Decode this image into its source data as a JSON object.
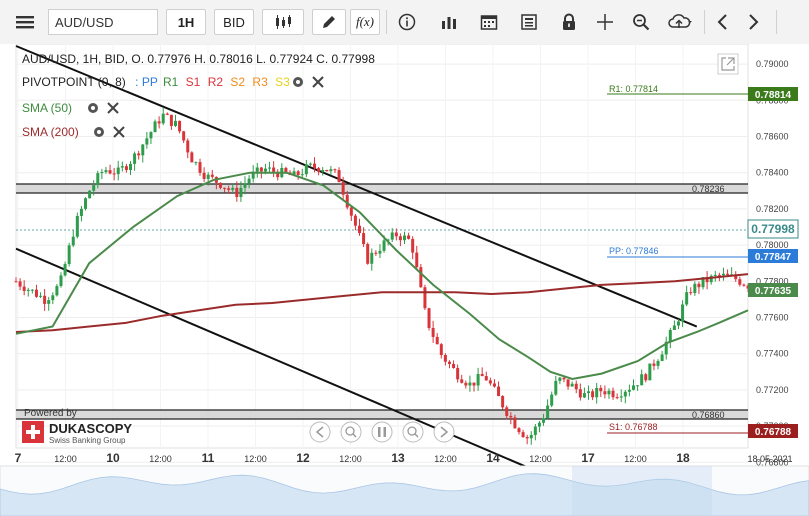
{
  "toolbar": {
    "symbol": "AUD/USD",
    "timeframe": "1H",
    "price_side": "BID",
    "fx_label": "f(x)"
  },
  "header": {
    "ohlc_line": "AUD/USD, 1H, BID,   O. 0.77976 H. 0.78016 L. 0.77924 C. 0.77998",
    "pivot_label": "PIVOTPOINT (0, 8)",
    "pivot_items": [
      {
        "text": ": PP",
        "color": "#2b7bd8"
      },
      {
        "text": "R1",
        "color": "#3d8b3d"
      },
      {
        "text": "S1",
        "color": "#d8343a"
      },
      {
        "text": "R2",
        "color": "#d8343a"
      },
      {
        "text": "S2",
        "color": "#f08a1c"
      },
      {
        "text": "R3",
        "color": "#f08a1c"
      },
      {
        "text": "S3",
        "color": "#e8d21c"
      }
    ],
    "sma50_label": "SMA (50)",
    "sma200_label": "SMA (200)"
  },
  "branding": {
    "powered_by": "Powered by",
    "name": "DUKASCOPY",
    "subtitle": "Swiss Banking Group"
  },
  "colors": {
    "up": "#2e9d4b",
    "down": "#d8343a",
    "sma50": "#4a8a4a",
    "sma200": "#9b2b2b",
    "pp": "#2b7bd8",
    "r1": "#3a7a1a",
    "s1": "#9b1f1f"
  },
  "chart_data": {
    "type": "candlestick",
    "symbol": "AUD/USD",
    "timeframe": "1H",
    "ylim": [
      0.7689,
      0.791
    ],
    "y_ticks": [
      "0.79000",
      "0.78800",
      "0.78600",
      "0.78400",
      "0.78200",
      "0.78000",
      "0.77800",
      "0.77600",
      "0.77400",
      "0.77200",
      "0.77000",
      "0.76800"
    ],
    "x_labels": [
      "7",
      "12:00",
      "10",
      "12:00",
      "11",
      "12:00",
      "12",
      "12:00",
      "13",
      "12:00",
      "14",
      "12:00",
      "17",
      "12:00",
      "18",
      "18.05.2021"
    ],
    "levels": [
      {
        "name": "R1",
        "label": "R1: 0.77814",
        "value": 0.77814,
        "tag": "0.78814",
        "color": "#3a7a1a"
      },
      {
        "name": "resistance",
        "label": "0.78236",
        "value": 0.78236
      },
      {
        "name": "PP",
        "label": "PP: 0.77846",
        "value": 0.77846,
        "tag": "0.77847",
        "color": "#2b7bd8"
      },
      {
        "name": "support",
        "label": "0.76860",
        "value": 0.7686
      },
      {
        "name": "S1",
        "label": "S1: 0.76788",
        "value": 0.76788,
        "tag": "0.76788",
        "color": "#9b1f1f"
      }
    ],
    "price_tags": [
      {
        "value": 0.77998,
        "text": "0.77998",
        "style": "current"
      },
      {
        "value": 0.77635,
        "text": "0.77635",
        "style": "sma50"
      }
    ],
    "trendlines": [
      {
        "from": [
          0.0,
          0.791
        ],
        "to": [
          0.93,
          0.7755
        ]
      },
      {
        "from": [
          0.0,
          0.7798
        ],
        "to": [
          0.7,
          0.7677
        ]
      }
    ],
    "sma50": [
      [
        0.0,
        0.7751
      ],
      [
        0.05,
        0.7755
      ],
      [
        0.1,
        0.779
      ],
      [
        0.16,
        0.781
      ],
      [
        0.22,
        0.7827
      ],
      [
        0.27,
        0.7836
      ],
      [
        0.32,
        0.784
      ],
      [
        0.37,
        0.784
      ],
      [
        0.42,
        0.7833
      ],
      [
        0.47,
        0.7818
      ],
      [
        0.52,
        0.7797
      ],
      [
        0.57,
        0.7778
      ],
      [
        0.62,
        0.7762
      ],
      [
        0.66,
        0.7748
      ],
      [
        0.7,
        0.7738
      ],
      [
        0.73,
        0.773
      ],
      [
        0.76,
        0.7726
      ],
      [
        0.8,
        0.7729
      ],
      [
        0.85,
        0.7736
      ],
      [
        0.89,
        0.7746
      ],
      [
        0.93,
        0.7752
      ],
      [
        0.96,
        0.7757
      ],
      [
        1.0,
        0.7764
      ]
    ],
    "sma200": [
      [
        0.0,
        0.7752
      ],
      [
        0.05,
        0.7753
      ],
      [
        0.1,
        0.7755
      ],
      [
        0.15,
        0.7757
      ],
      [
        0.2,
        0.7761
      ],
      [
        0.25,
        0.7764
      ],
      [
        0.3,
        0.7767
      ],
      [
        0.35,
        0.7768
      ],
      [
        0.4,
        0.777
      ],
      [
        0.45,
        0.7772
      ],
      [
        0.5,
        0.7774
      ],
      [
        0.55,
        0.7774
      ],
      [
        0.6,
        0.7774
      ],
      [
        0.65,
        0.7773
      ],
      [
        0.7,
        0.7774
      ],
      [
        0.75,
        0.7776
      ],
      [
        0.8,
        0.7778
      ],
      [
        0.85,
        0.7779
      ],
      [
        0.9,
        0.778
      ],
      [
        0.95,
        0.7782
      ],
      [
        1.0,
        0.7784
      ]
    ],
    "price_path": [
      [
        0.0,
        0.778
      ],
      [
        0.02,
        0.7775
      ],
      [
        0.04,
        0.777
      ],
      [
        0.06,
        0.7778
      ],
      [
        0.08,
        0.781
      ],
      [
        0.1,
        0.783
      ],
      [
        0.12,
        0.7842
      ],
      [
        0.14,
        0.784
      ],
      [
        0.16,
        0.7848
      ],
      [
        0.18,
        0.786
      ],
      [
        0.2,
        0.7872
      ],
      [
        0.22,
        0.7866
      ],
      [
        0.24,
        0.7848
      ],
      [
        0.26,
        0.7838
      ],
      [
        0.28,
        0.7834
      ],
      [
        0.3,
        0.7828
      ],
      [
        0.32,
        0.7838
      ],
      [
        0.34,
        0.7842
      ],
      [
        0.36,
        0.784
      ],
      [
        0.38,
        0.7838
      ],
      [
        0.4,
        0.7843
      ],
      [
        0.42,
        0.7843
      ],
      [
        0.44,
        0.7838
      ],
      [
        0.46,
        0.7815
      ],
      [
        0.48,
        0.7792
      ],
      [
        0.5,
        0.78
      ],
      [
        0.52,
        0.7806
      ],
      [
        0.54,
        0.7802
      ],
      [
        0.56,
        0.776
      ],
      [
        0.58,
        0.774
      ],
      [
        0.6,
        0.773
      ],
      [
        0.62,
        0.7723
      ],
      [
        0.64,
        0.7728
      ],
      [
        0.66,
        0.7715
      ],
      [
        0.68,
        0.7702
      ],
      [
        0.7,
        0.7693
      ],
      [
        0.72,
        0.7705
      ],
      [
        0.74,
        0.7726
      ],
      [
        0.76,
        0.7722
      ],
      [
        0.78,
        0.7716
      ],
      [
        0.8,
        0.772
      ],
      [
        0.82,
        0.7718
      ],
      [
        0.84,
        0.7722
      ],
      [
        0.86,
        0.7728
      ],
      [
        0.88,
        0.774
      ],
      [
        0.9,
        0.7755
      ],
      [
        0.92,
        0.7775
      ],
      [
        0.94,
        0.778
      ],
      [
        0.96,
        0.7783
      ],
      [
        0.98,
        0.7782
      ],
      [
        1.0,
        0.7778
      ]
    ]
  }
}
